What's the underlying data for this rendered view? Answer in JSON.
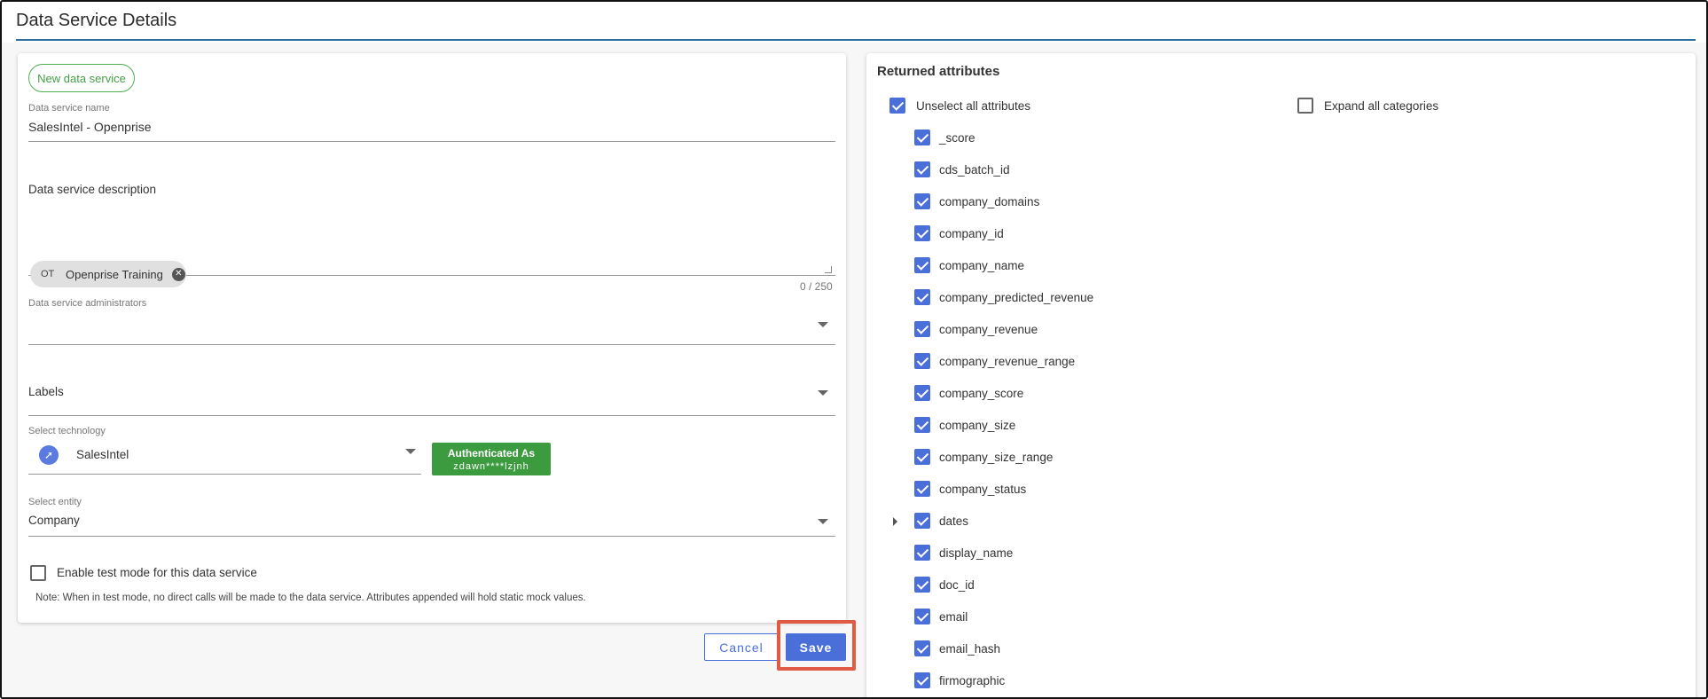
{
  "header": {
    "title": "Data Service Details"
  },
  "form": {
    "new_button_label": "New data service",
    "name_label": "Data service name",
    "name_value": "SalesIntel - Openprise",
    "description_label": "Data service description",
    "description_counter": "0 / 250",
    "administrators_label": "Data service administrators",
    "admin_chip": {
      "initials": "OT",
      "name": "Openprise Training"
    },
    "labels_label": "Labels",
    "technology_label": "Select technology",
    "technology_value": "SalesIntel",
    "auth_badge": {
      "title": "Authenticated As",
      "user": "zdawn****lzjnh"
    },
    "entity_label": "Select entity",
    "entity_value": "Company",
    "test_mode_label": "Enable test mode for this data service",
    "test_mode_checked": false,
    "note": "Note: When in test mode, no direct calls will be made to the data service. Attributes appended will hold static mock values."
  },
  "actions": {
    "cancel_label": "Cancel",
    "save_label": "Save"
  },
  "attributes": {
    "title": "Returned attributes",
    "unselect_all_label": "Unselect all attributes",
    "expand_all_label": "Expand all categories",
    "items": [
      {
        "label": "_score",
        "checked": true
      },
      {
        "label": "cds_batch_id",
        "checked": true
      },
      {
        "label": "company_domains",
        "checked": true
      },
      {
        "label": "company_id",
        "checked": true
      },
      {
        "label": "company_name",
        "checked": true
      },
      {
        "label": "company_predicted_revenue",
        "checked": true
      },
      {
        "label": "company_revenue",
        "checked": true
      },
      {
        "label": "company_revenue_range",
        "checked": true
      },
      {
        "label": "company_score",
        "checked": true
      },
      {
        "label": "company_size",
        "checked": true
      },
      {
        "label": "company_size_range",
        "checked": true
      },
      {
        "label": "company_status",
        "checked": true
      },
      {
        "label": "dates",
        "checked": true,
        "expandable": true
      },
      {
        "label": "display_name",
        "checked": true
      },
      {
        "label": "doc_id",
        "checked": true
      },
      {
        "label": "email",
        "checked": true
      },
      {
        "label": "email_hash",
        "checked": true
      },
      {
        "label": "firmographic",
        "checked": true
      }
    ]
  },
  "colors": {
    "accent": "#4a6fd8",
    "success": "#3c9a3f",
    "highlight": "#e05a44"
  }
}
